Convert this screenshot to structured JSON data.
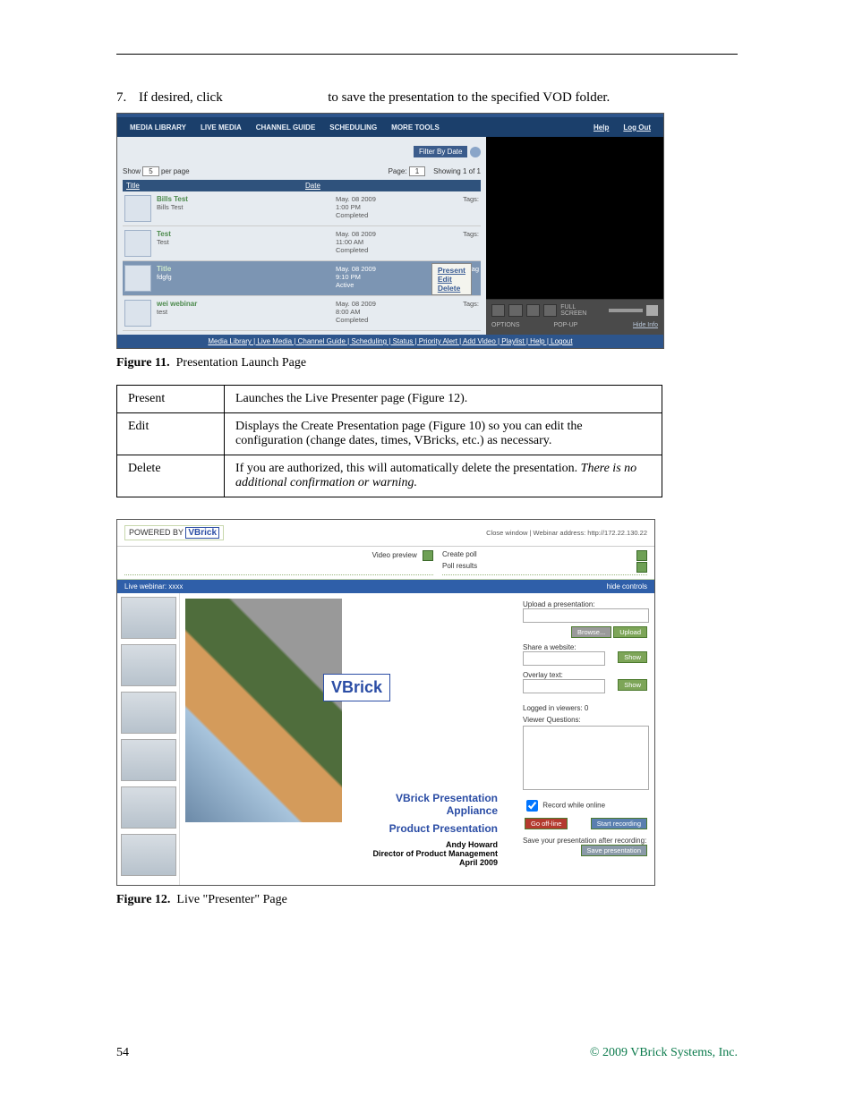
{
  "step": {
    "num": "7.",
    "text_before": "If desired, click ",
    "text_after": " to save the presentation to the specified VOD folder."
  },
  "screenshot1": {
    "menu": [
      "MEDIA LIBRARY",
      "LIVE MEDIA",
      "CHANNEL GUIDE",
      "SCHEDULING",
      "MORE TOOLS"
    ],
    "help": "Help",
    "logout": "Log Out",
    "filter_by_date": "Filter By Date",
    "show": "Show",
    "per_page": "per page",
    "show_val": "5",
    "page_label": "Page:",
    "page_val": "1",
    "showing": "Showing 1 of 1",
    "th_title": "Title",
    "th_date": "Date",
    "rows": [
      {
        "title": "Bills Test",
        "sub": "Bills Test",
        "date": "May. 08 2009",
        "time": "1:00 PM",
        "state": "Completed",
        "tags": "Tags:"
      },
      {
        "title": "Test",
        "sub": "Test",
        "date": "May. 08 2009",
        "time": "11:00 AM",
        "state": "Completed",
        "tags": "Tags:"
      },
      {
        "title": "Title",
        "sub": "fdgfg",
        "date": "May. 08 2009",
        "time": "9:10 PM",
        "state": "Active",
        "tags": "Tag",
        "sel": true
      },
      {
        "title": "wei webinar",
        "sub": "test",
        "date": "May. 08 2009",
        "time": "8:00 AM",
        "state": "Completed",
        "tags": "Tags:"
      }
    ],
    "popup": [
      "Present",
      "Edit",
      "Delete"
    ],
    "full_screen": "FULL SCREEN",
    "options": "OPTIONS",
    "popup_btn": "POP-UP",
    "hide_info": "Hide Info",
    "footer": "Media Library | Live Media | Channel Guide | Scheduling | Status | Priority Alert | Add Video | Playlist | Help | Logout"
  },
  "caption1": {
    "label": "Figure 11.",
    "text": "Presentation Launch Page"
  },
  "table": {
    "rows": [
      {
        "k": "Present",
        "v": "Launches the Live Presenter page (Figure 12)."
      },
      {
        "k": "Edit",
        "v": "Displays the Create Presentation page (Figure 10) so you can edit the configuration (change dates, times, VBricks, etc.) as necessary."
      },
      {
        "k": "Delete",
        "v_pre": "If you are authorized, this will automatically delete the presentation. ",
        "v_it": "There is no additional confirmation or warning."
      }
    ]
  },
  "screenshot2": {
    "powered_by": "POWERED BY",
    "brand": "VBrick",
    "close": "Close window | Webinar address: http://172.22.130.22",
    "video_preview": "Video preview",
    "create_poll": "Create poll",
    "poll_results": "Poll results",
    "live_webinar": "Live webinar: xxxx",
    "hide_controls": "hide controls",
    "stage": {
      "l1": "VBrick",
      "l2": "VBrick Presentation",
      "l3": "Appliance",
      "l4": "Product Presentation",
      "l5": "Andy Howard",
      "l6": "Director of Product Management",
      "l7": "April 2009"
    },
    "side": {
      "upload": "Upload a presentation:",
      "browse": "Browse...",
      "upload_btn": "Upload",
      "share": "Share a website:",
      "show": "Show",
      "overlay": "Overlay text:",
      "logged": "Logged in viewers: 0",
      "questions": "Viewer Questions:",
      "record_while": "Record while online",
      "go_off": "Go off-line",
      "start_rec": "Start recording",
      "save_after": "Save your presentation after recording:",
      "save_pres": "Save presentation"
    }
  },
  "caption2": {
    "label": "Figure 12.",
    "text": "Live \"Presenter\" Page"
  },
  "footer": {
    "page": "54",
    "copyright": "© 2009 VBrick Systems, Inc."
  }
}
